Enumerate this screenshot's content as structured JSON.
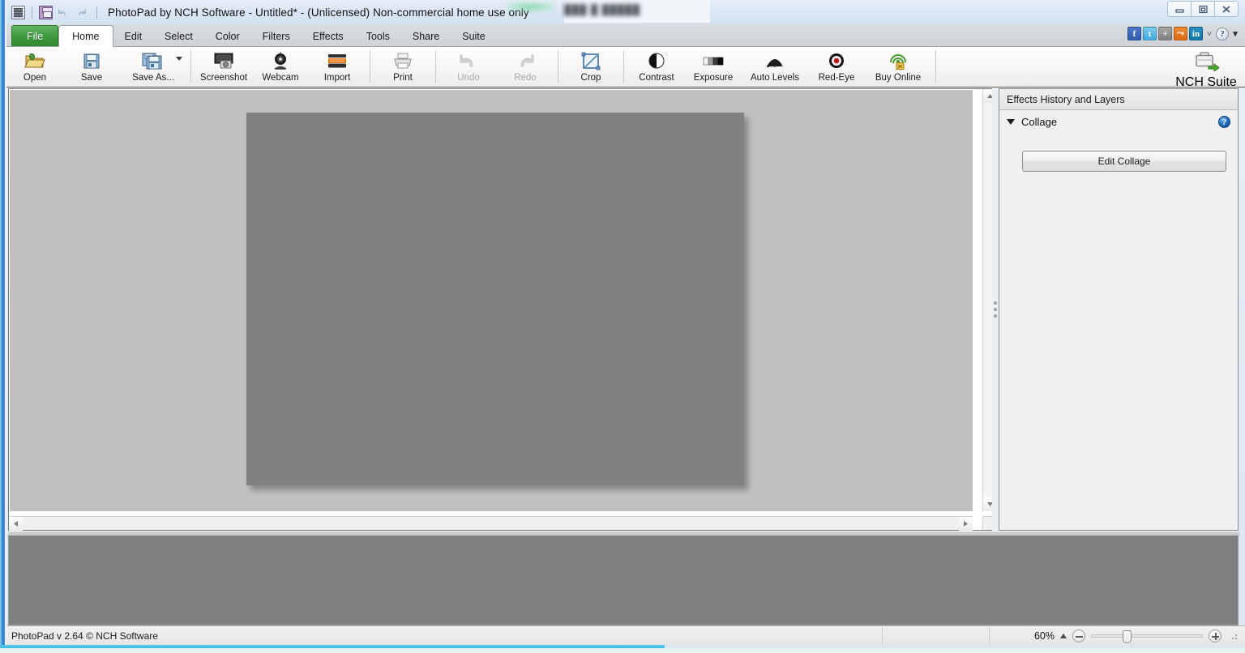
{
  "window": {
    "title": "PhotoPad by NCH Software - Untitled* - (Unlicensed) Non-commercial home use only",
    "blurred_text": "███ █ █████",
    "controls": {
      "minimize": "minimize-button",
      "maximize": "maximize-button",
      "close": "close-button"
    }
  },
  "quick_access": {
    "app_icon": "photopad-app-icon",
    "items": [
      {
        "name": "save-icon",
        "label": "Save"
      },
      {
        "name": "undo-icon",
        "label": "Undo"
      },
      {
        "name": "redo-icon",
        "label": "Redo"
      }
    ]
  },
  "tabs": {
    "file_label": "File",
    "items": [
      {
        "label": "Home",
        "active": true
      },
      {
        "label": "Edit",
        "active": false
      },
      {
        "label": "Select",
        "active": false
      },
      {
        "label": "Color",
        "active": false
      },
      {
        "label": "Filters",
        "active": false
      },
      {
        "label": "Effects",
        "active": false
      },
      {
        "label": "Tools",
        "active": false
      },
      {
        "label": "Share",
        "active": false
      },
      {
        "label": "Suite",
        "active": false
      }
    ]
  },
  "social": {
    "items": [
      {
        "name": "facebook-icon",
        "glyph": "f"
      },
      {
        "name": "twitter-icon",
        "glyph": "t"
      },
      {
        "name": "googleplus-icon",
        "glyph": "+"
      },
      {
        "name": "stumbleupon-icon",
        "glyph": "⤳"
      },
      {
        "name": "linkedin-icon",
        "glyph": "in"
      }
    ],
    "chevron": "˅",
    "help": "?",
    "arrow": "▾"
  },
  "toolbar": {
    "groups": [
      {
        "items": [
          {
            "label": "Open",
            "icon": "open-folder-icon",
            "disabled": false,
            "dropdown": false
          },
          {
            "label": "Save",
            "icon": "save-disk-icon",
            "disabled": false,
            "dropdown": false
          },
          {
            "label": "Save As...",
            "icon": "save-as-icon",
            "disabled": false,
            "dropdown": true
          }
        ]
      },
      {
        "items": [
          {
            "label": "Screenshot",
            "icon": "screenshot-icon",
            "disabled": false,
            "dropdown": false
          },
          {
            "label": "Webcam",
            "icon": "webcam-icon",
            "disabled": false,
            "dropdown": false
          },
          {
            "label": "Import",
            "icon": "import-scanner-icon",
            "disabled": false,
            "dropdown": false
          }
        ]
      },
      {
        "items": [
          {
            "label": "Print",
            "icon": "printer-icon",
            "disabled": false,
            "dropdown": false
          }
        ]
      },
      {
        "items": [
          {
            "label": "Undo",
            "icon": "undo-arrow-icon",
            "disabled": true,
            "dropdown": false
          },
          {
            "label": "Redo",
            "icon": "redo-arrow-icon",
            "disabled": true,
            "dropdown": false
          }
        ]
      },
      {
        "items": [
          {
            "label": "Crop",
            "icon": "crop-icon",
            "disabled": false,
            "dropdown": false
          }
        ]
      },
      {
        "items": [
          {
            "label": "Contrast",
            "icon": "contrast-circle-icon",
            "disabled": false,
            "dropdown": false
          },
          {
            "label": "Exposure",
            "icon": "exposure-gradient-icon",
            "disabled": false,
            "dropdown": false
          },
          {
            "label": "Auto Levels",
            "icon": "auto-levels-histogram-icon",
            "disabled": false,
            "dropdown": false
          },
          {
            "label": "Red-Eye",
            "icon": "red-eye-icon",
            "disabled": false,
            "dropdown": false
          },
          {
            "label": "Buy Online",
            "icon": "buy-online-broadcast-icon",
            "disabled": false,
            "dropdown": false
          }
        ]
      }
    ],
    "nch_suite": {
      "label": "NCH Suite",
      "icon": "briefcase-icon"
    }
  },
  "right_panel": {
    "header": "Effects History and Layers",
    "section_title": "Collage",
    "help_glyph": "?",
    "edit_collage_label": "Edit Collage"
  },
  "status": {
    "text": "PhotoPad v 2.64 © NCH Software",
    "zoom_value": "60%",
    "zoom_minus": "zoom-out-button",
    "zoom_plus": "zoom-in-button"
  },
  "colors": {
    "file_tab_green": "#3e9b3e",
    "canvas_bg": "#c0c0c0",
    "photo_gray": "#808080",
    "lower_pane_gray": "#808080",
    "window_border_cyan": "#35b5e0"
  }
}
